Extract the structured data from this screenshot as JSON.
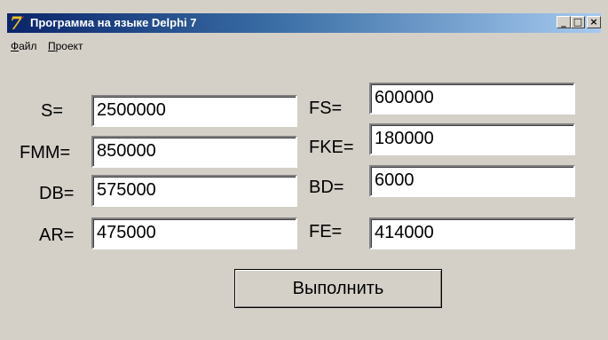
{
  "window": {
    "title": "Программа на языке Delphi 7",
    "icon": "delphi-7-icon",
    "controls": {
      "minimize": "_",
      "maximize": "□",
      "close": "×"
    }
  },
  "menu": {
    "items": [
      {
        "label": "Файл",
        "mnemonic": "Ф"
      },
      {
        "label": "Проект",
        "mnemonic": "П"
      }
    ]
  },
  "fields": {
    "S": {
      "label": "S=",
      "value": "2500000"
    },
    "FMM": {
      "label": "FMM=",
      "value": "850000"
    },
    "DB": {
      "label": "DB=",
      "value": "575000"
    },
    "AR": {
      "label": "AR=",
      "value": "475000"
    },
    "FS": {
      "label": "FS=",
      "value": "600000"
    },
    "FKE": {
      "label": "FKE=",
      "value": "180000"
    },
    "BD": {
      "label": "BD=",
      "value": "6000"
    },
    "FE": {
      "label": "FE=",
      "value": "414000"
    }
  },
  "actions": {
    "run_label": "Выполнить"
  }
}
